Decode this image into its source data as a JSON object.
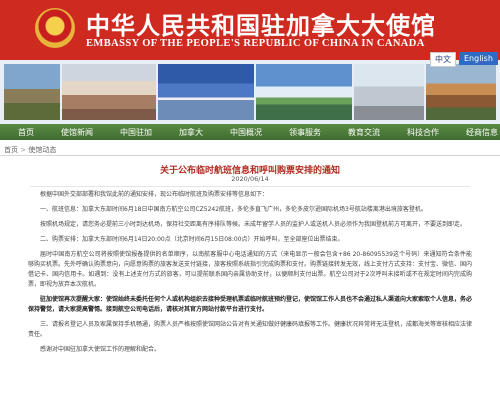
{
  "header": {
    "title_cn": "中华人民共和国驻加拿大大使馆",
    "title_en": "EMBASSY OF THE PEOPLE'S REPUBLIC OF CHINA IN CANADA",
    "lang_cn": "中文",
    "lang_en": "English"
  },
  "nav": {
    "items": [
      "首页",
      "使馆新闻",
      "中国驻加",
      "加拿大",
      "中国概况",
      "领事服务",
      "教育交流",
      "科技合作",
      "经商信息"
    ]
  },
  "breadcrumb": {
    "home": "首页",
    "sep": ">",
    "section": "使馆动态"
  },
  "article": {
    "title": "关于公布临时航班信息和呼叫购票安排的通知",
    "date": "2020/06/14",
    "paragraphs": [
      "根据中国外交部部署和我馆此前的通知安排，现公布临时航班及购票安排等信息如下：",
      "一、航班信息：加拿大东部时间6月18日中国南方航空公司CZ5242航班，多伦多直飞广州，多伦多皮尔逊国际机场3号航站楼离港出境旅客登机。",
      "按照机场规定，请您务必提前三小时到达机场，保持社交距离有序排队等候。未成年留学人员的监护人或送机人员必须作为我国登机前方可离开，不要送到即走。",
      "二、购票安排：加拿大东部时间6月14日20:00点（北京时间6月15日08:00点）开始呼叫，至全部座位出票结束。",
      "届时中国南方航空公司将按照使馆报备提供的名单顺序，以南航客服中心电话通知的方式（来电显示一般会包含+86 20-86095539这个号码）来通知符合条件能够购买机票。先外呼确认购票意向，向愿意购票的旅客发送支付链接，旅客按照系统指引完成购票和支付。购票链接转发无效，线上支付方式支持：支付宝、微信、国内借记卡、国内信用卡。如遇到：没有上述支付方式的旅客，可以提前联系国内亲属协助支付，以便顺利支付出票。航空公司对于2次呼叫未接听或不在规定时间内完成购票，即视为放弃本次航机。",
      "驻加使馆再次提醒大家：使馆始终未委托任何个人或机构组织去接种受理机票或临时航班预约登记，使馆馆工作人员也不会通过私人渠道向大家索取个人信息，务必保持警觉，请大家提高警惕。接到航空公司电话后，请核对其官方网站付款平台进行支付。",
      "三、请报名登记人员及家属保持手机畅通，购票人员严格按照使馆网站公告对有关通知做好健康码填报等工作。健康状况异常将无法登机，成都海关等审核相应法律责任。",
      "感谢对中国驻加拿大使馆工作的理解和配合。"
    ]
  },
  "colors": {
    "header_red": "#cf2a20",
    "nav_green": "#4a7a3a",
    "title_red": "#b02d21",
    "english_btn_blue": "#2e6bc6"
  }
}
